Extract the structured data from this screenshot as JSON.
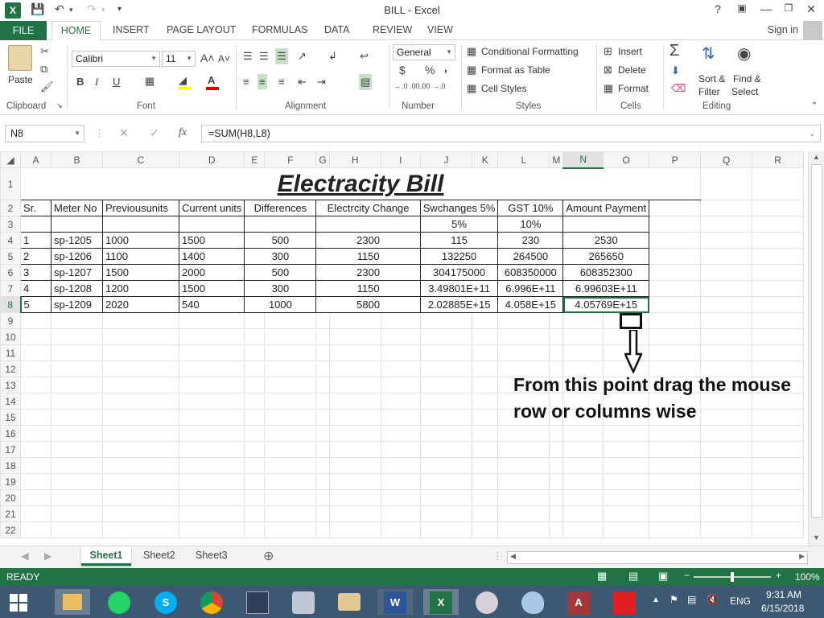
{
  "window": {
    "title": "BILL - Excel"
  },
  "ribbon": {
    "tabs": [
      "FILE",
      "HOME",
      "INSERT",
      "PAGE LAYOUT",
      "FORMULAS",
      "DATA",
      "REVIEW",
      "VIEW"
    ],
    "sign_in": "Sign in",
    "clipboard": {
      "paste": "Paste",
      "label": "Clipboard"
    },
    "font": {
      "name": "Calibri",
      "size": "11",
      "label": "Font",
      "bold": "B",
      "italic": "I",
      "underline": "U",
      "font_color": "A"
    },
    "alignment": {
      "label": "Alignment"
    },
    "number": {
      "format": "General",
      "label": "Number",
      "currency": "$",
      "percent": "%",
      "comma": ",",
      "inc_decimal": "←.0 .00",
      "dec_decimal": ".00 →.0"
    },
    "styles": {
      "conditional": "Conditional Formatting",
      "table": "Format as Table",
      "cell_styles": "Cell Styles",
      "label": "Styles"
    },
    "cells": {
      "insert": "Insert",
      "delete": "Delete",
      "format": "Format",
      "label": "Cells"
    },
    "editing": {
      "sum": "Σ",
      "sort": "Sort &",
      "filter": "Filter",
      "find": "Find &",
      "select": "Select",
      "label": "Editing"
    }
  },
  "formula_bar": {
    "name_box": "N8",
    "fx": "fx",
    "formula": "=SUM(H8,L8)"
  },
  "sheet": {
    "columns": [
      "A",
      "B",
      "C",
      "D",
      "E",
      "F",
      "G",
      "H",
      "I",
      "J",
      "K",
      "L",
      "M",
      "N",
      "O",
      "P",
      "Q",
      "R"
    ],
    "rows": [
      "1",
      "2",
      "3",
      "4",
      "5",
      "6",
      "7",
      "8",
      "9",
      "10",
      "11",
      "12",
      "13",
      "14",
      "15",
      "16",
      "17",
      "18",
      "19",
      "20",
      "21",
      "22"
    ],
    "title": "Electracity Bill",
    "headers": [
      "Sr.",
      "Meter No",
      "Previousunits",
      "Current units",
      "Differences",
      "Electrcity Change",
      "Swchanges 5%",
      "GST 10%",
      "Amount Payment"
    ],
    "rates": {
      "sw": "5%",
      "gst": "10%"
    },
    "data": [
      [
        "1",
        "sp-1205",
        "1000",
        "1500",
        "500",
        "2300",
        "115",
        "230",
        "2530"
      ],
      [
        "2",
        "sp-1206",
        "1100",
        "1400",
        "300",
        "1150",
        "132250",
        "264500",
        "265650"
      ],
      [
        "3",
        "sp-1207",
        "1500",
        "2000",
        "500",
        "2300",
        "304175000",
        "608350000",
        "608352300"
      ],
      [
        "4",
        "sp-1208",
        "1200",
        "1500",
        "300",
        "1150",
        "3.49801E+11",
        "6.996E+11",
        "6.99603E+11"
      ],
      [
        "5",
        "sp-1209",
        "2020",
        "540",
        "1000",
        "5800",
        "2.02885E+15",
        "4.058E+15",
        "4.05769E+15"
      ]
    ],
    "annotation_line1": "From this point drag the mouse",
    "annotation_line2": "row or columns wise"
  },
  "sheet_tabs": [
    "Sheet1",
    "Sheet2",
    "Sheet3"
  ],
  "status": {
    "ready": "READY",
    "zoom": "100%"
  },
  "taskbar": {
    "lang": "ENG",
    "time": "9:31 AM",
    "date": "6/15/2018"
  },
  "colors": {
    "excel_green": "#217346",
    "taskbar": "#3c5873"
  }
}
